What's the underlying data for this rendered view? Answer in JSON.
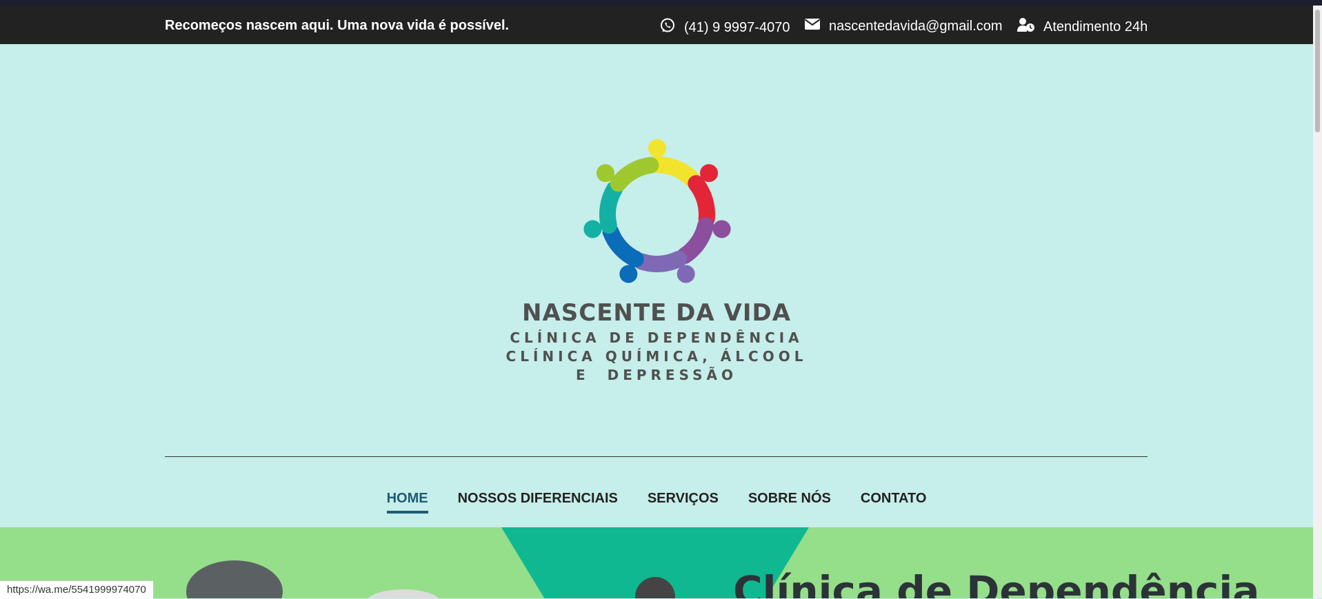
{
  "topbar": {
    "tagline": "Recomeços nascem aqui. Uma nova vida é possível.",
    "phone": "(41) 9 9997-4070",
    "email": "nascentedavida@gmail.com",
    "hours": "Atendimento 24h",
    "icons": [
      "whatsapp-icon",
      "envelope-icon",
      "user-clock-icon"
    ]
  },
  "brand": {
    "name": "NASCENTE DA VIDA",
    "line1": "CLÍNICA DE DEPENDÊNCIA",
    "line2": "CLÍNICA QUÍMICA, ÁLCOOL",
    "line3": "E  DEPRESSÃO",
    "logo_colors": [
      "#f2e32c",
      "#e32637",
      "#8b4f9e",
      "#7f69b5",
      "#0b6cb9",
      "#15b0a4",
      "#9fc82f"
    ]
  },
  "nav": {
    "items": [
      {
        "label": "HOME",
        "active": true
      },
      {
        "label": "NOSSOS DIFERENCIAIS",
        "active": false
      },
      {
        "label": "SERVIÇOS",
        "active": false
      },
      {
        "label": "SOBRE NÓS",
        "active": false
      },
      {
        "label": "CONTATO",
        "active": false
      }
    ]
  },
  "hero": {
    "title": "Clínica de Dependência"
  },
  "status": {
    "url": "https://wa.me/5541999974070"
  },
  "colors": {
    "topbar_bg": "#222222",
    "header_bg": "#c6eeea",
    "nav_active": "#1f5a72",
    "hero_bg": "#95de8a",
    "hero_accent": "#0fb890"
  }
}
